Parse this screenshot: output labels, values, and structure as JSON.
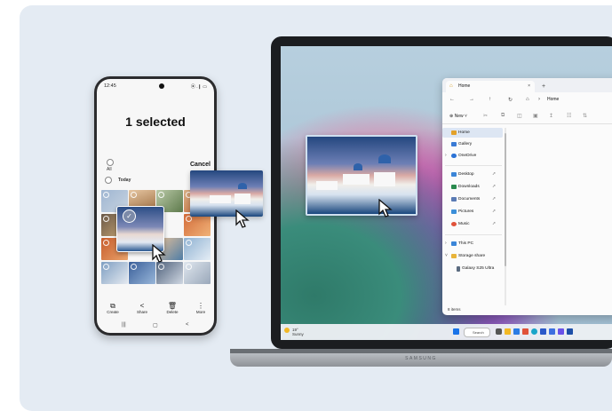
{
  "phone": {
    "status_time": "12:45",
    "status_icons": "⦿ .❙ ▭",
    "title": "1 selected",
    "all_label": "All",
    "today_label": "Today",
    "cancel_label": "Cancel",
    "actions": [
      {
        "icon": "⧉",
        "label": "Create"
      },
      {
        "icon": "<",
        "label": "Share"
      },
      {
        "icon": "🗑",
        "label": "Delete"
      },
      {
        "icon": "⋮",
        "label": "More"
      }
    ],
    "nav": [
      "|||",
      "▢",
      "<"
    ]
  },
  "explorer": {
    "tab_title": "Home",
    "tab_close": "×",
    "tab_add": "+",
    "nav_buttons": [
      "←",
      "→",
      "↑",
      "↻",
      "⌂",
      "›"
    ],
    "breadcrumb": "Home",
    "new_label": "New",
    "sidebar": [
      {
        "label": "Home",
        "icon": "home-icon",
        "color": "#e3a12a"
      },
      {
        "label": "Gallery",
        "icon": "gallery-icon",
        "color": "#3a7bd5"
      },
      {
        "label": "OneDrive",
        "icon": "cloud-icon",
        "color": "#2b73d6"
      },
      {
        "label": "Desktop",
        "icon": "desktop-icon",
        "color": "#3b86d8"
      },
      {
        "label": "Downloads",
        "icon": "download-icon",
        "color": "#2a8a4e"
      },
      {
        "label": "Documents",
        "icon": "documents-icon",
        "color": "#5a7bb4"
      },
      {
        "label": "Pictures",
        "icon": "pictures-icon",
        "color": "#3c8fd9"
      },
      {
        "label": "Music",
        "icon": "music-icon",
        "color": "#e0523a"
      },
      {
        "label": "This PC",
        "icon": "computer-icon",
        "color": "#3b86d8"
      },
      {
        "label": "Storage share",
        "icon": "folder-icon",
        "color": "#e8b43a"
      },
      {
        "label": "Galaxy S25 Ultra",
        "icon": "phone-icon",
        "color": "#5b6b80"
      }
    ],
    "status": "8 items"
  },
  "taskbar": {
    "weather_temp": "19°",
    "weather_text": "Sunny",
    "search_label": "Search"
  },
  "laptop": {
    "brand": "SAMSUNG"
  }
}
